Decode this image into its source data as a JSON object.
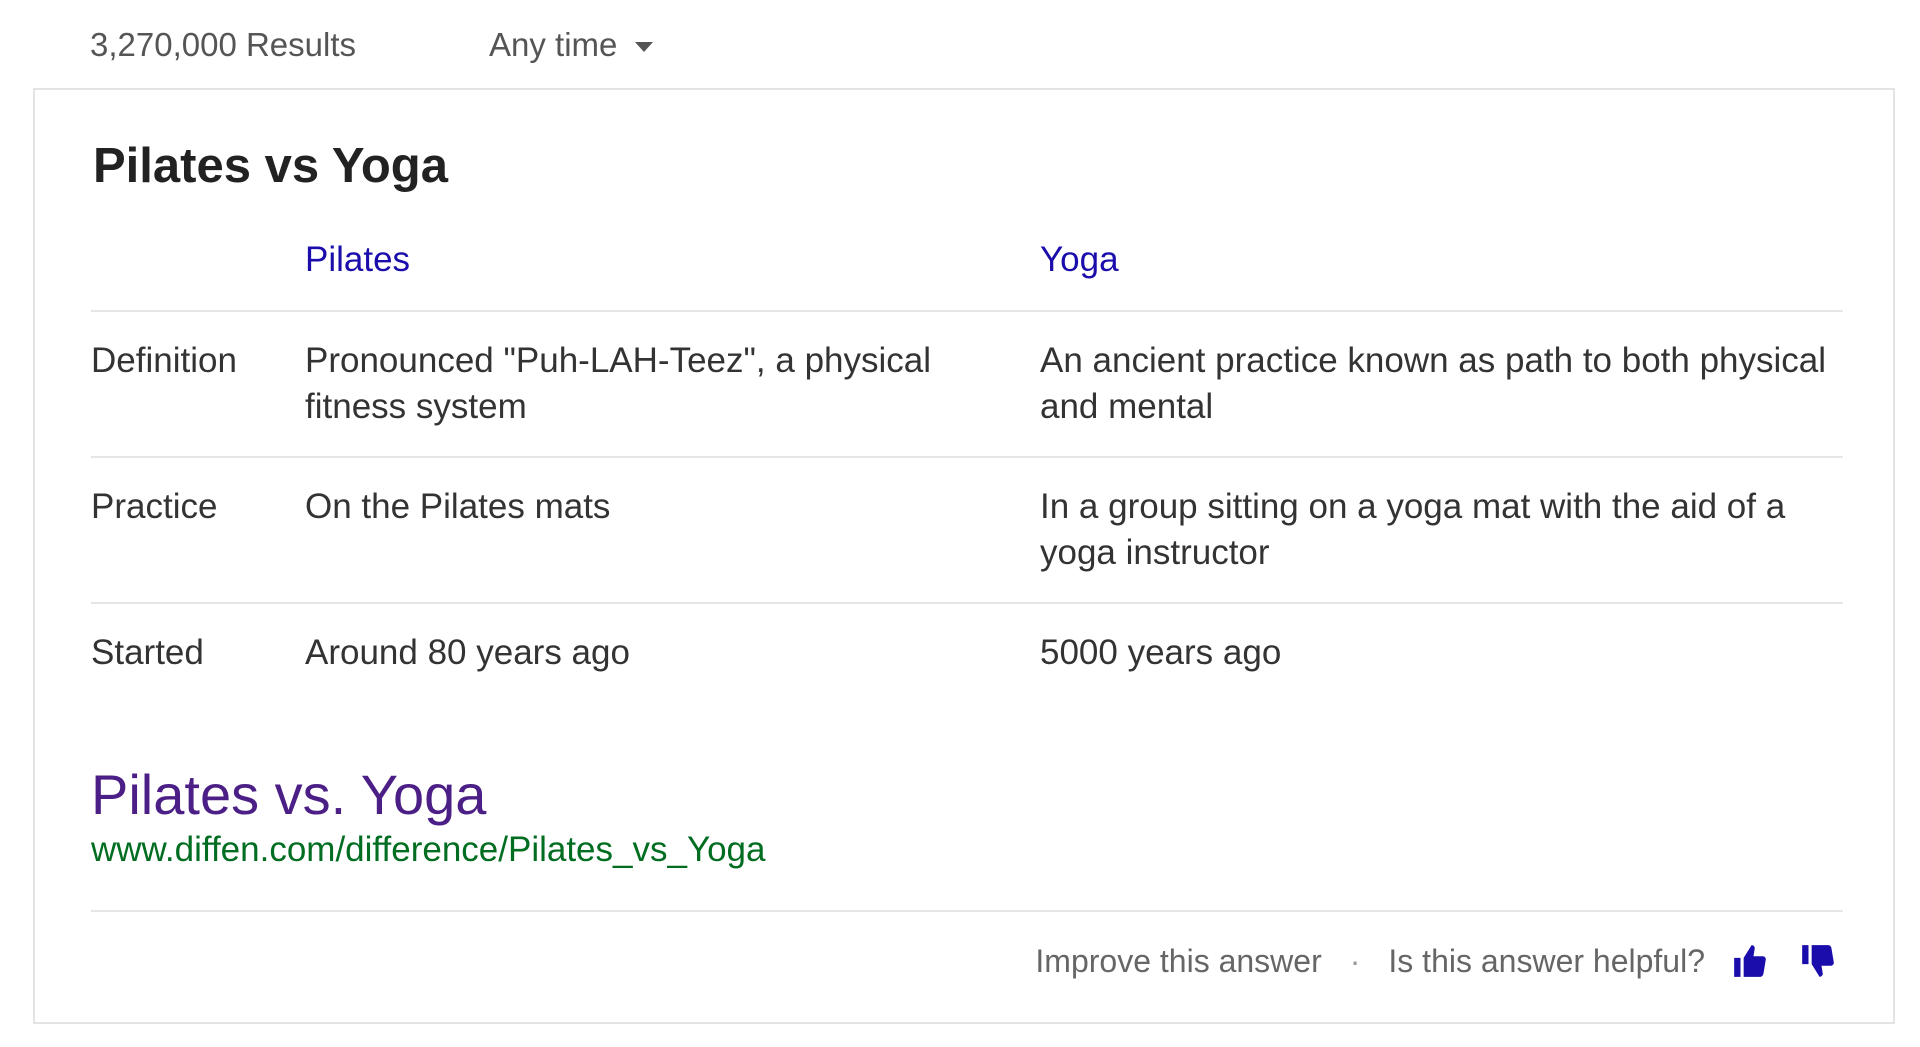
{
  "header": {
    "results_count": "3,270,000 Results",
    "time_filter": "Any time"
  },
  "card": {
    "title": "Pilates vs Yoga",
    "columns": [
      "Pilates",
      "Yoga"
    ],
    "rows": [
      {
        "label": "Definition",
        "pilates": "Pronounced \"Puh-LAH-Teez\", a physical fitness system",
        "yoga": "An ancient practice known as path to both physical and mental"
      },
      {
        "label": "Practice",
        "pilates": "On the Pilates mats",
        "yoga": "In a group sitting on a yoga mat with the aid of a yoga instructor"
      },
      {
        "label": "Started",
        "pilates": "Around 80 years ago",
        "yoga": "5000 years ago"
      }
    ],
    "source_title": "Pilates vs. Yoga",
    "source_url": "www.diffen.com/difference/Pilates_vs_Yoga"
  },
  "footer": {
    "improve_label": "Improve this answer",
    "separator": "·",
    "helpful_label": "Is this answer helpful?",
    "thumbs_up_icon": "thumbs-up-icon",
    "thumbs_down_icon": "thumbs-down-icon"
  },
  "colors": {
    "link_blue": "#1a0dab",
    "visited_purple": "#4b1f86",
    "url_green": "#006d21",
    "icon_blue": "#1a0dab"
  }
}
